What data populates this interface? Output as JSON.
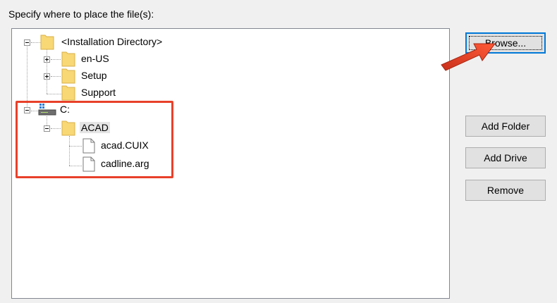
{
  "header": {
    "label": "Specify where to place the file(s):"
  },
  "tree": {
    "root": {
      "label": "<Installation Directory>"
    },
    "root_children": [
      {
        "label": "en-US"
      },
      {
        "label": "Setup"
      },
      {
        "label": "Support"
      }
    ],
    "drive": {
      "label": "C:"
    },
    "acad": {
      "label": "ACAD"
    },
    "acad_files": [
      {
        "label": "acad.CUIX"
      },
      {
        "label": "cadline.arg"
      }
    ]
  },
  "buttons": {
    "browse": "Browse...",
    "add_folder": "Add Folder",
    "add_drive": "Add Drive",
    "remove": "Remove"
  },
  "colors": {
    "highlight": "#e8412a",
    "folder": "#f8d775",
    "focus": "#0078d7"
  },
  "icons": {
    "folder": "folder-icon",
    "file": "file-icon",
    "drive": "drive-icon",
    "expand": "expand-icon",
    "collapse": "collapse-icon"
  }
}
